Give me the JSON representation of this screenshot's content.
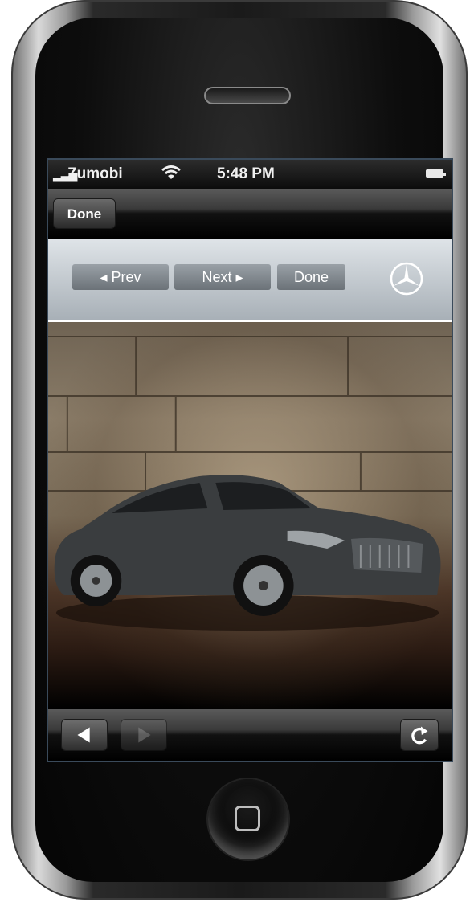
{
  "status_bar": {
    "carrier": "Zumobi",
    "time": "5:48 PM"
  },
  "nav_bar": {
    "done_label": "Done"
  },
  "content_toolbar": {
    "prev_label": "◂ Prev",
    "next_label": "Next ▸",
    "done_label": "Done"
  },
  "icons": {
    "signal": "signal-bars-icon",
    "wifi": "wifi-icon",
    "battery": "battery-icon",
    "logo": "mercedes-star-icon",
    "back": "back-arrow-icon",
    "forward": "forward-arrow-icon",
    "reload": "reload-icon",
    "home": "home-square-icon"
  },
  "colors": {
    "toolbar_top": "#dfe4e8",
    "toolbar_bottom": "#a8b0b7",
    "button_grey": "#7e858b",
    "bar_black": "#000000"
  }
}
